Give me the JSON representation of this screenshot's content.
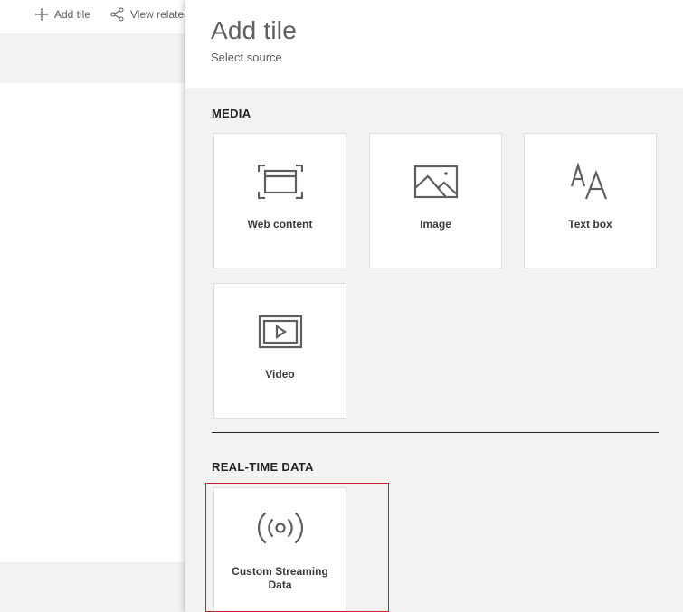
{
  "toolbar": {
    "add_tile": "Add tile",
    "view_related": "View related"
  },
  "panel": {
    "title": "Add tile",
    "subtitle": "Select source"
  },
  "sections": {
    "media": {
      "heading": "MEDIA",
      "tiles": [
        {
          "label": "Web content",
          "icon": "web-content-icon"
        },
        {
          "label": "Image",
          "icon": "image-icon"
        },
        {
          "label": "Text box",
          "icon": "text-box-icon"
        },
        {
          "label": "Video",
          "icon": "video-icon"
        }
      ]
    },
    "realtime": {
      "heading": "REAL-TIME DATA",
      "tiles": [
        {
          "label": "Custom Streaming Data",
          "icon": "streaming-icon"
        }
      ]
    }
  },
  "colors": {
    "panel_bg": "#f3f2f1",
    "icon": "#605e5c",
    "highlight": "#c4262e"
  }
}
